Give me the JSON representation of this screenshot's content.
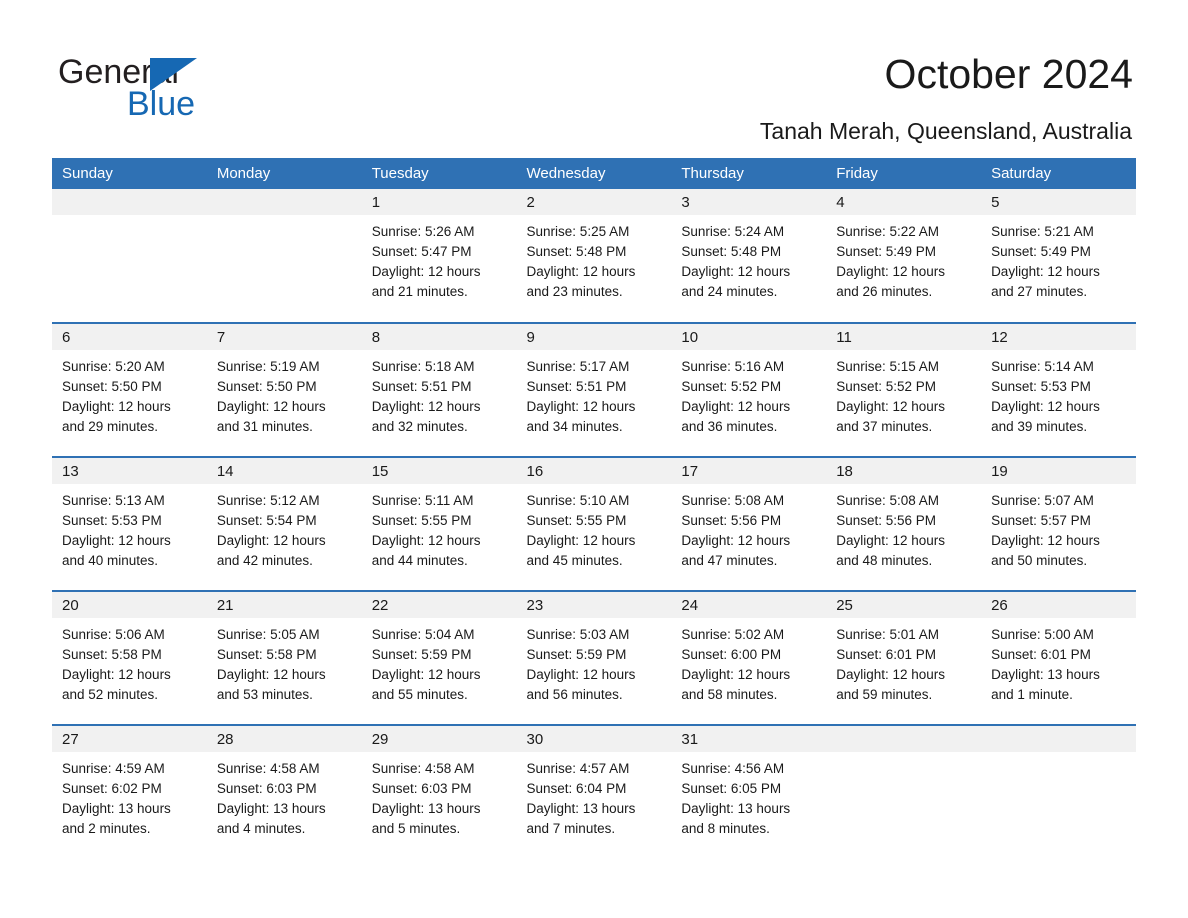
{
  "brand": {
    "name_part1": "General",
    "name_part2": "Blue"
  },
  "header": {
    "title": "October 2024",
    "subtitle": "Tanah Merah, Queensland, Australia"
  },
  "calendar": {
    "weekday_headers": [
      "Sunday",
      "Monday",
      "Tuesday",
      "Wednesday",
      "Thursday",
      "Friday",
      "Saturday"
    ],
    "colors": {
      "header_blue": "#2f71b4",
      "daynum_band": "#f1f1f1",
      "row_divider": "#2f71b4",
      "text": "#1a1a1a",
      "brand_blue": "#1668b3"
    },
    "weeks": [
      [
        {
          "day": "",
          "sunrise": "",
          "sunset": "",
          "daylight1": "",
          "daylight2": ""
        },
        {
          "day": "",
          "sunrise": "",
          "sunset": "",
          "daylight1": "",
          "daylight2": ""
        },
        {
          "day": "1",
          "sunrise": "Sunrise: 5:26 AM",
          "sunset": "Sunset: 5:47 PM",
          "daylight1": "Daylight: 12 hours",
          "daylight2": "and 21 minutes."
        },
        {
          "day": "2",
          "sunrise": "Sunrise: 5:25 AM",
          "sunset": "Sunset: 5:48 PM",
          "daylight1": "Daylight: 12 hours",
          "daylight2": "and 23 minutes."
        },
        {
          "day": "3",
          "sunrise": "Sunrise: 5:24 AM",
          "sunset": "Sunset: 5:48 PM",
          "daylight1": "Daylight: 12 hours",
          "daylight2": "and 24 minutes."
        },
        {
          "day": "4",
          "sunrise": "Sunrise: 5:22 AM",
          "sunset": "Sunset: 5:49 PM",
          "daylight1": "Daylight: 12 hours",
          "daylight2": "and 26 minutes."
        },
        {
          "day": "5",
          "sunrise": "Sunrise: 5:21 AM",
          "sunset": "Sunset: 5:49 PM",
          "daylight1": "Daylight: 12 hours",
          "daylight2": "and 27 minutes."
        }
      ],
      [
        {
          "day": "6",
          "sunrise": "Sunrise: 5:20 AM",
          "sunset": "Sunset: 5:50 PM",
          "daylight1": "Daylight: 12 hours",
          "daylight2": "and 29 minutes."
        },
        {
          "day": "7",
          "sunrise": "Sunrise: 5:19 AM",
          "sunset": "Sunset: 5:50 PM",
          "daylight1": "Daylight: 12 hours",
          "daylight2": "and 31 minutes."
        },
        {
          "day": "8",
          "sunrise": "Sunrise: 5:18 AM",
          "sunset": "Sunset: 5:51 PM",
          "daylight1": "Daylight: 12 hours",
          "daylight2": "and 32 minutes."
        },
        {
          "day": "9",
          "sunrise": "Sunrise: 5:17 AM",
          "sunset": "Sunset: 5:51 PM",
          "daylight1": "Daylight: 12 hours",
          "daylight2": "and 34 minutes."
        },
        {
          "day": "10",
          "sunrise": "Sunrise: 5:16 AM",
          "sunset": "Sunset: 5:52 PM",
          "daylight1": "Daylight: 12 hours",
          "daylight2": "and 36 minutes."
        },
        {
          "day": "11",
          "sunrise": "Sunrise: 5:15 AM",
          "sunset": "Sunset: 5:52 PM",
          "daylight1": "Daylight: 12 hours",
          "daylight2": "and 37 minutes."
        },
        {
          "day": "12",
          "sunrise": "Sunrise: 5:14 AM",
          "sunset": "Sunset: 5:53 PM",
          "daylight1": "Daylight: 12 hours",
          "daylight2": "and 39 minutes."
        }
      ],
      [
        {
          "day": "13",
          "sunrise": "Sunrise: 5:13 AM",
          "sunset": "Sunset: 5:53 PM",
          "daylight1": "Daylight: 12 hours",
          "daylight2": "and 40 minutes."
        },
        {
          "day": "14",
          "sunrise": "Sunrise: 5:12 AM",
          "sunset": "Sunset: 5:54 PM",
          "daylight1": "Daylight: 12 hours",
          "daylight2": "and 42 minutes."
        },
        {
          "day": "15",
          "sunrise": "Sunrise: 5:11 AM",
          "sunset": "Sunset: 5:55 PM",
          "daylight1": "Daylight: 12 hours",
          "daylight2": "and 44 minutes."
        },
        {
          "day": "16",
          "sunrise": "Sunrise: 5:10 AM",
          "sunset": "Sunset: 5:55 PM",
          "daylight1": "Daylight: 12 hours",
          "daylight2": "and 45 minutes."
        },
        {
          "day": "17",
          "sunrise": "Sunrise: 5:08 AM",
          "sunset": "Sunset: 5:56 PM",
          "daylight1": "Daylight: 12 hours",
          "daylight2": "and 47 minutes."
        },
        {
          "day": "18",
          "sunrise": "Sunrise: 5:08 AM",
          "sunset": "Sunset: 5:56 PM",
          "daylight1": "Daylight: 12 hours",
          "daylight2": "and 48 minutes."
        },
        {
          "day": "19",
          "sunrise": "Sunrise: 5:07 AM",
          "sunset": "Sunset: 5:57 PM",
          "daylight1": "Daylight: 12 hours",
          "daylight2": "and 50 minutes."
        }
      ],
      [
        {
          "day": "20",
          "sunrise": "Sunrise: 5:06 AM",
          "sunset": "Sunset: 5:58 PM",
          "daylight1": "Daylight: 12 hours",
          "daylight2": "and 52 minutes."
        },
        {
          "day": "21",
          "sunrise": "Sunrise: 5:05 AM",
          "sunset": "Sunset: 5:58 PM",
          "daylight1": "Daylight: 12 hours",
          "daylight2": "and 53 minutes."
        },
        {
          "day": "22",
          "sunrise": "Sunrise: 5:04 AM",
          "sunset": "Sunset: 5:59 PM",
          "daylight1": "Daylight: 12 hours",
          "daylight2": "and 55 minutes."
        },
        {
          "day": "23",
          "sunrise": "Sunrise: 5:03 AM",
          "sunset": "Sunset: 5:59 PM",
          "daylight1": "Daylight: 12 hours",
          "daylight2": "and 56 minutes."
        },
        {
          "day": "24",
          "sunrise": "Sunrise: 5:02 AM",
          "sunset": "Sunset: 6:00 PM",
          "daylight1": "Daylight: 12 hours",
          "daylight2": "and 58 minutes."
        },
        {
          "day": "25",
          "sunrise": "Sunrise: 5:01 AM",
          "sunset": "Sunset: 6:01 PM",
          "daylight1": "Daylight: 12 hours",
          "daylight2": "and 59 minutes."
        },
        {
          "day": "26",
          "sunrise": "Sunrise: 5:00 AM",
          "sunset": "Sunset: 6:01 PM",
          "daylight1": "Daylight: 13 hours",
          "daylight2": "and 1 minute."
        }
      ],
      [
        {
          "day": "27",
          "sunrise": "Sunrise: 4:59 AM",
          "sunset": "Sunset: 6:02 PM",
          "daylight1": "Daylight: 13 hours",
          "daylight2": "and 2 minutes."
        },
        {
          "day": "28",
          "sunrise": "Sunrise: 4:58 AM",
          "sunset": "Sunset: 6:03 PM",
          "daylight1": "Daylight: 13 hours",
          "daylight2": "and 4 minutes."
        },
        {
          "day": "29",
          "sunrise": "Sunrise: 4:58 AM",
          "sunset": "Sunset: 6:03 PM",
          "daylight1": "Daylight: 13 hours",
          "daylight2": "and 5 minutes."
        },
        {
          "day": "30",
          "sunrise": "Sunrise: 4:57 AM",
          "sunset": "Sunset: 6:04 PM",
          "daylight1": "Daylight: 13 hours",
          "daylight2": "and 7 minutes."
        },
        {
          "day": "31",
          "sunrise": "Sunrise: 4:56 AM",
          "sunset": "Sunset: 6:05 PM",
          "daylight1": "Daylight: 13 hours",
          "daylight2": "and 8 minutes."
        },
        {
          "day": "",
          "sunrise": "",
          "sunset": "",
          "daylight1": "",
          "daylight2": ""
        },
        {
          "day": "",
          "sunrise": "",
          "sunset": "",
          "daylight1": "",
          "daylight2": ""
        }
      ]
    ]
  }
}
